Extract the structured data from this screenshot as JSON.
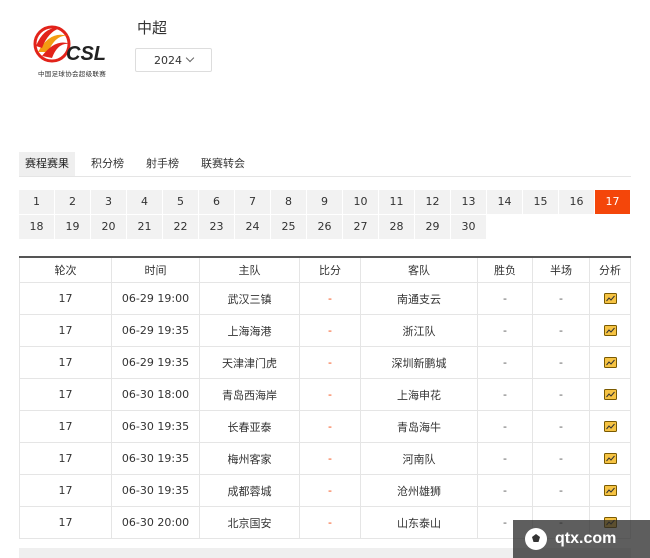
{
  "header": {
    "logo_text": "CSL",
    "logo_caption": "中国足球协会超级联赛",
    "title": "中超",
    "season": "2024"
  },
  "tabs": [
    "赛程赛果",
    "积分榜",
    "射手榜",
    "联赛转会"
  ],
  "rounds": [
    "1",
    "2",
    "3",
    "4",
    "5",
    "6",
    "7",
    "8",
    "9",
    "10",
    "11",
    "12",
    "13",
    "14",
    "15",
    "16",
    "17",
    "18",
    "19",
    "20",
    "21",
    "22",
    "23",
    "24",
    "25",
    "26",
    "27",
    "28",
    "29",
    "30"
  ],
  "active_round": "17",
  "table": {
    "headers": [
      "轮次",
      "时间",
      "主队",
      "比分",
      "客队",
      "胜负",
      "半场",
      "分析"
    ],
    "rows": [
      {
        "round": "17",
        "time": "06-29 19:00",
        "home": "武汉三镇",
        "score": "-",
        "away": "南通支云",
        "result": "-",
        "half": "-"
      },
      {
        "round": "17",
        "time": "06-29 19:35",
        "home": "上海海港",
        "score": "-",
        "away": "浙江队",
        "result": "-",
        "half": "-"
      },
      {
        "round": "17",
        "time": "06-29 19:35",
        "home": "天津津门虎",
        "score": "-",
        "away": "深圳新鹏城",
        "result": "-",
        "half": "-"
      },
      {
        "round": "17",
        "time": "06-30 18:00",
        "home": "青岛西海岸",
        "score": "-",
        "away": "上海申花",
        "result": "-",
        "half": "-"
      },
      {
        "round": "17",
        "time": "06-30 19:35",
        "home": "长春亚泰",
        "score": "-",
        "away": "青岛海牛",
        "result": "-",
        "half": "-"
      },
      {
        "round": "17",
        "time": "06-30 19:35",
        "home": "梅州客家",
        "score": "-",
        "away": "河南队",
        "result": "-",
        "half": "-"
      },
      {
        "round": "17",
        "time": "06-30 19:35",
        "home": "成都蓉城",
        "score": "-",
        "away": "沧州雄狮",
        "result": "-",
        "half": "-"
      },
      {
        "round": "17",
        "time": "06-30 20:00",
        "home": "北京国安",
        "score": "-",
        "away": "山东泰山",
        "result": "-",
        "half": "-"
      }
    ]
  },
  "watermark": "qtx.com",
  "colors": {
    "accent": "#f4460a"
  }
}
